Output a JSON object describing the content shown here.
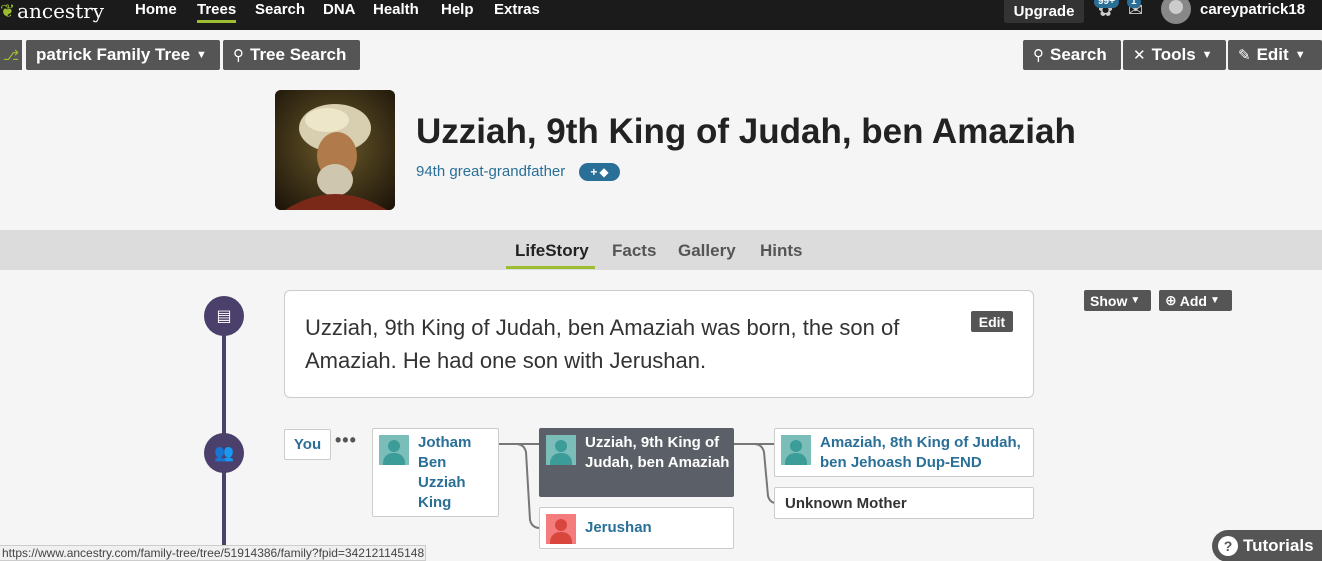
{
  "topnav": {
    "brand": "ancestry",
    "links": [
      "Home",
      "Trees",
      "Search",
      "DNA",
      "Health",
      "Help",
      "Extras"
    ],
    "upgrade": "Upgrade",
    "hints_badge": "99+",
    "messages_badge": "1",
    "username": "careypatrick18"
  },
  "toolbar": {
    "tree_name": "patrick Family Tree",
    "tree_search": "Tree Search",
    "search": "Search",
    "tools": "Tools",
    "edit": "Edit"
  },
  "profile": {
    "name": "Uzziah, 9th King of Judah, ben Amaziah",
    "relationship": "94th great-grandfather",
    "tag_button": "+"
  },
  "tabs": [
    "LifeStory",
    "Facts",
    "Gallery",
    "Hints"
  ],
  "story": {
    "text": "Uzziah, 9th King of Judah, ben Amaziah was born, the son of Amaziah. He had one son with Jerushan.",
    "edit": "Edit",
    "show": "Show",
    "add": "Add"
  },
  "family": {
    "you": "You",
    "child": "Jotham Ben Uzziah King",
    "focus": "Uzziah, 9th King of Judah, ben Amaziah",
    "spouse": "Jerushan",
    "father": "Amaziah, 8th King of Judah, ben Jehoash Dup-END",
    "mother": "Unknown Mother"
  },
  "status_url": "https://www.ancestry.com/family-tree/tree/51914386/family?fpid=342121145148",
  "tutorials": "Tutorials",
  "colors": {
    "accent": "#9cbe30",
    "link": "#2a6f97",
    "timeline": "#4b3f6b"
  }
}
